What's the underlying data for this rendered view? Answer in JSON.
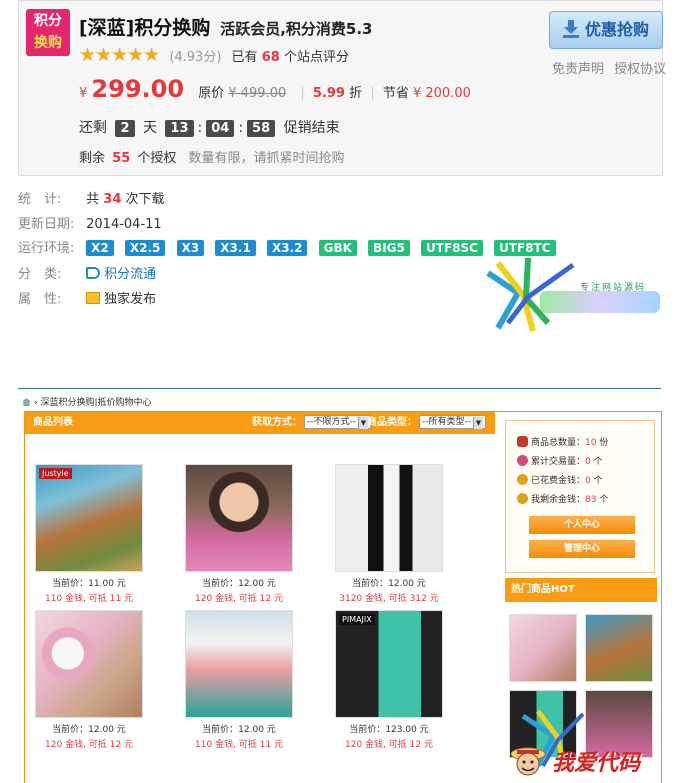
{
  "product": {
    "logo_line1": "积分",
    "logo_line2": "换购",
    "title": "[深蓝]积分换购",
    "subtitle": "活跃会员,积分消费5.3",
    "stars": "★★★★★",
    "score": "(4.93分)",
    "rating_prefix": "已有",
    "rating_count": "68",
    "rating_suffix": "个站点评分",
    "buy_label": "优惠抢购",
    "disclaimer": "免责声明",
    "license_agreement": "授权协议",
    "currency": "¥",
    "price": "299.00",
    "original_label": "原价",
    "original_price": "¥ 499.00",
    "discount": "5.99",
    "discount_unit": "折",
    "save_label": "节省",
    "save_amount": "¥ 200.00",
    "countdown_prefix": "还剩",
    "days": "2",
    "days_unit": "天",
    "hours": "13",
    "minutes": "04",
    "seconds": "58",
    "countdown_suffix": "促销结束",
    "remaining_prefix": "剩余",
    "remaining_count": "55",
    "remaining_suffix": "个授权",
    "remaining_note": "数量有限，请抓紧时间抢购"
  },
  "info": {
    "stats_label": "统　计:",
    "stats_prefix": "共",
    "stats_count": "34",
    "stats_suffix": "次下载",
    "updated_label": "更新日期:",
    "updated_value": "2014-04-11",
    "env_label": "运行环境:",
    "env_tags": [
      "X2",
      "X2.5",
      "X3",
      "X3.1",
      "X3.2",
      "GBK",
      "BIG5",
      "UTF8SC",
      "UTF8TC"
    ],
    "category_label": "分　类:",
    "category_value": "积分流通",
    "attr_label": "属　性:",
    "attr_value": "独家发布"
  },
  "watermark_top": "专注网站源码",
  "watermark_bottom": "我爱代码",
  "shop": {
    "breadcrumb": "深蓝积分换购|抵价购物中心",
    "list_title": "商品列表",
    "filter1_label": "获取方式：",
    "filter1_value": "--不限方式--",
    "filter2_label": "商品类型：",
    "filter2_value": "--所有类型--",
    "products": [
      {
        "price": "当前价：11.00 元",
        "gold": "110 金钱, 可抵 11 元",
        "tag": "Justyle"
      },
      {
        "price": "当前价：12.00 元",
        "gold": "120 金钱, 可抵 12 元",
        "tag": ""
      },
      {
        "price": "当前价：12.00 元",
        "gold": "3120 金钱, 可抵 312 元",
        "tag": ""
      },
      {
        "price": "当前价：12.00 元",
        "gold": "120 金钱, 可抵 12 元",
        "tag": ""
      },
      {
        "price": "当前价：12.00 元",
        "gold": "110 金钱, 可抵 11 元",
        "tag": ""
      },
      {
        "price": "当前价：123.00 元",
        "gold": "120 金钱, 可抵 12 元",
        "tag": "PIMAJIX"
      }
    ],
    "stats": [
      {
        "label": "商品总数量：",
        "value": "10",
        "unit": " 份",
        "color": "#c0392b"
      },
      {
        "label": "累计交易量：",
        "value": "0",
        "unit": " 个",
        "color": "#d4477f"
      },
      {
        "label": "已花费金钱：",
        "value": "0",
        "unit": " 个",
        "color": "#e0a21a"
      },
      {
        "label": "我剩余金钱：",
        "value": "83",
        "unit": " 个",
        "color": "#e0a21a"
      }
    ],
    "personal_center": "个人中心",
    "manage_center": "管理中心",
    "hot_title": "热门商品HOT"
  }
}
